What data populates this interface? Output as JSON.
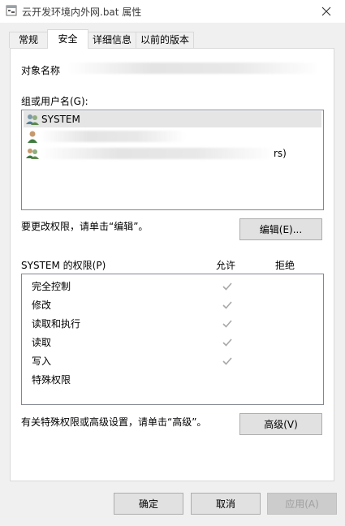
{
  "window": {
    "title": "云开发环境内外网.bat 属性",
    "close_icon": "close-icon",
    "file_icon": "bat-file-icon"
  },
  "tabs": [
    {
      "label": "常规",
      "active": false
    },
    {
      "label": "安全",
      "active": true
    },
    {
      "label": "详细信息",
      "active": false
    },
    {
      "label": "以前的版本",
      "active": false
    }
  ],
  "security": {
    "object_name_label": "对象名称",
    "group_label": "组或用户名(G):",
    "users": [
      {
        "name": "SYSTEM",
        "icon": "group-users-icon",
        "selected": true
      },
      {
        "name": "",
        "icon": "user-icon",
        "selected": false
      },
      {
        "name": "rs)",
        "icon": "group-users-icon",
        "selected": false
      }
    ],
    "edit_hint": "要更改权限，请单击“编辑”。",
    "edit_button": "编辑(E)...",
    "permissions_for": "SYSTEM 的权限(P)",
    "allow_header": "允许",
    "deny_header": "拒绝",
    "permissions": [
      {
        "name": "完全控制",
        "allow": true,
        "deny": false
      },
      {
        "name": "修改",
        "allow": true,
        "deny": false
      },
      {
        "name": "读取和执行",
        "allow": true,
        "deny": false
      },
      {
        "name": "读取",
        "allow": true,
        "deny": false
      },
      {
        "name": "写入",
        "allow": true,
        "deny": false
      },
      {
        "name": "特殊权限",
        "allow": false,
        "deny": false
      }
    ],
    "advanced_hint": "有关特殊权限或高级设置，请单击“高级”。",
    "advanced_button": "高级(V)"
  },
  "footer": {
    "ok": "确定",
    "cancel": "取消",
    "apply": "应用(A)"
  }
}
